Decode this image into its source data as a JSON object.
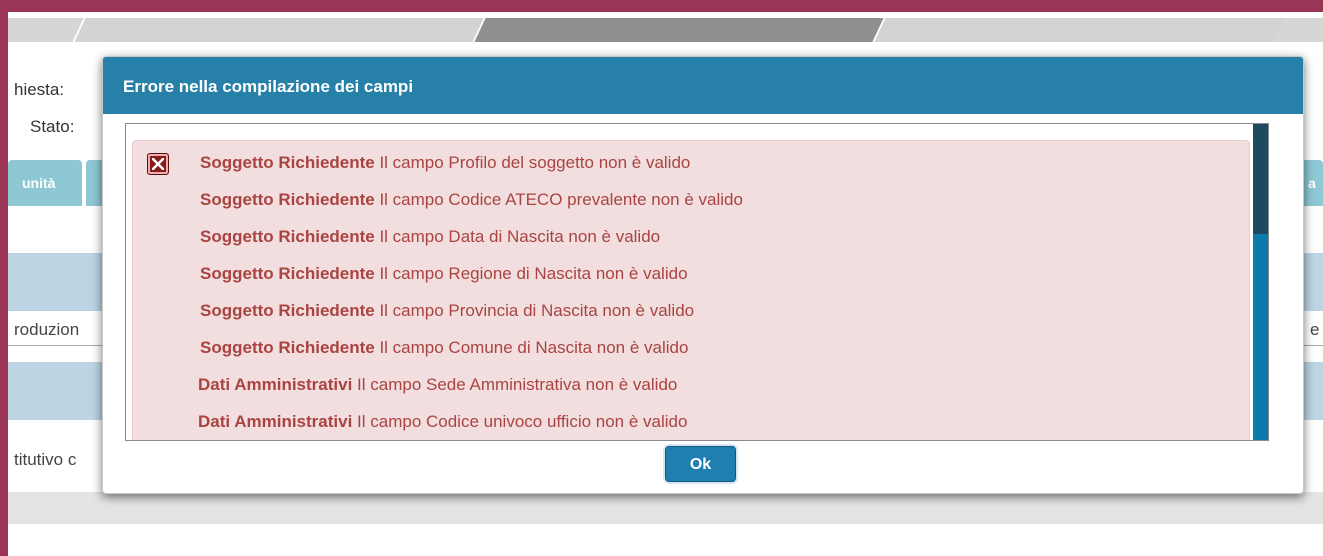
{
  "background": {
    "labels": {
      "richiesta": "hiesta:",
      "stato": "Stato:",
      "tab_left": "unità",
      "tab_right": "a",
      "row1_left": "roduzion",
      "row1_right": "e",
      "row2_left": "titutivo c"
    }
  },
  "dialog": {
    "title": "Errore nella compilazione dei campi",
    "ok_label": "Ok",
    "errors": [
      {
        "section": "Soggetto Richiedente",
        "message": "Il campo Profilo del soggetto non è valido"
      },
      {
        "section": "Soggetto Richiedente",
        "message": "Il campo Codice ATECO prevalente non è valido"
      },
      {
        "section": "Soggetto Richiedente",
        "message": "Il campo Data di Nascita non è valido"
      },
      {
        "section": "Soggetto Richiedente",
        "message": "Il campo Regione di Nascita non è valido"
      },
      {
        "section": "Soggetto Richiedente",
        "message": "Il campo Provincia di Nascita non è valido"
      },
      {
        "section": "Soggetto Richiedente",
        "message": "Il campo Comune di Nascita non è valido"
      },
      {
        "section": "Dati Amministrativi",
        "message": "Il campo Sede Amministrativa non è valido"
      },
      {
        "section": "Dati Amministrativi",
        "message": "Il campo Codice univoco ufficio non è valido"
      }
    ]
  },
  "colors": {
    "frame": "#9a3555",
    "header": "#2680a8",
    "error_text": "#a94442",
    "error_bg": "#f2dede"
  },
  "icons": {
    "error": "close-x-icon"
  }
}
